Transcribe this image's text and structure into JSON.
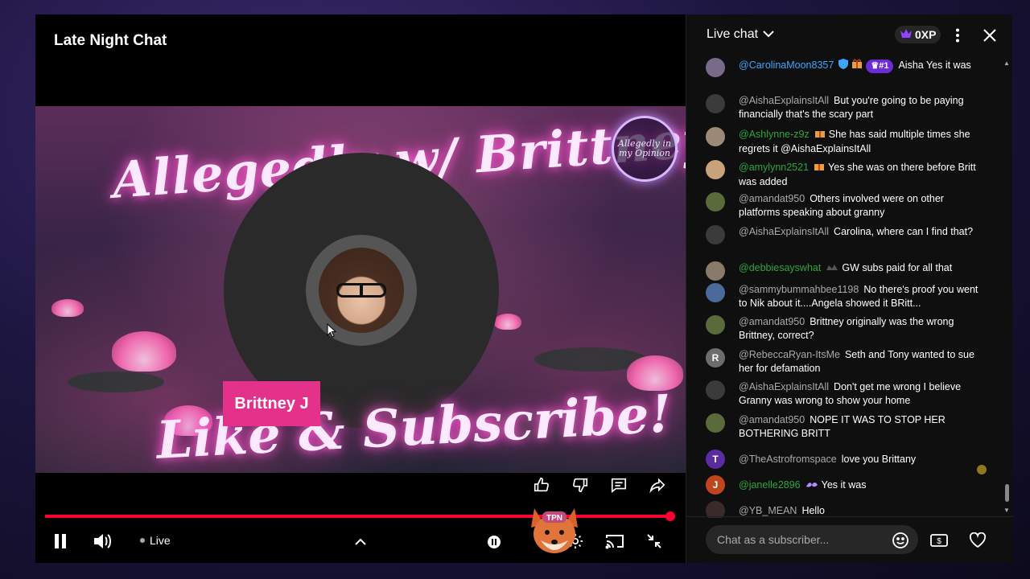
{
  "player": {
    "title": "Late Night Chat",
    "banner_text": "Allegedly w/ Brittney J",
    "cta_text": "Like & Subscribe!",
    "logo_text": "Allegedly in my Opinion",
    "speaker_name": "Brittney J",
    "live_label": "Live",
    "progress": 1.0,
    "accent_color": "#ff0033",
    "name_tag_color": "#e4328a",
    "mascot_text": "TPN"
  },
  "chat": {
    "title": "Live chat",
    "xp_label": "0XP",
    "input_placeholder": "Chat as a subscriber...",
    "messages": [
      {
        "author": "@CarolinaMoon8357",
        "rank": "#1",
        "text": "Aisha Yes it was",
        "avatar_color": "#7a6a8a",
        "avatar_letter": "",
        "member": false
      },
      {
        "author": "@AishaExplainsItAll",
        "text": "But you're going to be paying financially that's the scary part",
        "avatar_color": "#3b3b3b",
        "avatar_letter": "",
        "member": false
      },
      {
        "author": "@Ashlynne-z9z",
        "text": "She has said multiple times she regrets it @AishaExplainsItAll",
        "avatar_color": "#9b8a78",
        "avatar_letter": "",
        "member": true
      },
      {
        "author": "@amylynn2521",
        "text": "Yes she was on there before Britt was added",
        "avatar_color": "#c8a27a",
        "avatar_letter": "",
        "member": true
      },
      {
        "author": "@amandat950",
        "text": "Others involved were on other platforms speaking about granny",
        "avatar_color": "#5a6a3a",
        "avatar_letter": "",
        "member": false
      },
      {
        "author": "@AishaExplainsItAll",
        "text": "Carolina, where can I find that?",
        "avatar_color": "#3b3b3b",
        "avatar_letter": "",
        "member": false
      },
      {
        "author": "@debbiesayswhat",
        "text": "GW subs paid for all that",
        "avatar_color": "#8a7a6a",
        "avatar_letter": "",
        "member": true
      },
      {
        "author": "@sammybummahbee1198",
        "text": "No there's proof you went to Nik about it....Angela showed it BRitt...",
        "avatar_color": "#4a6a9a",
        "avatar_letter": "",
        "member": false
      },
      {
        "author": "@amandat950",
        "text": "Brittney originally was the wrong Brittney, correct?",
        "avatar_color": "#5a6a3a",
        "avatar_letter": "",
        "member": false
      },
      {
        "author": "@RebeccaRyan-ItsMe",
        "text": "Seth and Tony wanted to sue her for defamation",
        "avatar_color": "#6d6d6d",
        "avatar_letter": "R",
        "member": false
      },
      {
        "author": "@AishaExplainsItAll",
        "text": "Don't get me wrong I believe Granny was wrong to show your home",
        "avatar_color": "#3b3b3b",
        "avatar_letter": "",
        "member": false
      },
      {
        "author": "@amandat950",
        "text": "NOPE IT WAS TO STOP HER BOTHERING BRITT",
        "avatar_color": "#5a6a3a",
        "avatar_letter": "",
        "member": false
      },
      {
        "author": "@TheAstrofromspace",
        "text": "love you Brittany",
        "avatar_color": "#5b2ca0",
        "avatar_letter": "T",
        "member": false
      },
      {
        "author": "@janelle2896",
        "text": "Yes it was",
        "avatar_color": "#c0451e",
        "avatar_letter": "J",
        "member": true
      },
      {
        "author": "@YB_MEAN",
        "text": "Hello",
        "avatar_color": "#3b2a2a",
        "avatar_letter": "",
        "member": false
      }
    ]
  },
  "icons": {
    "like": "thumb-up-icon",
    "dislike": "thumb-down-icon",
    "comment": "comment-icon",
    "share": "share-icon",
    "pause": "pause-icon",
    "volume": "volume-icon",
    "chevron_up": "chevron-up-icon",
    "cast": "cast-icon",
    "exit_fullscreen": "exit-fullscreen-icon",
    "menu": "more-vert-icon",
    "close": "close-icon",
    "emoji": "emoji-icon",
    "super_chat": "super-chat-icon",
    "heart": "heart-icon",
    "crown": "crown-icon"
  },
  "colors": {
    "chat_bg": "#0f0f0f",
    "member_name": "#2ba640",
    "author_name": "#aaaaaa",
    "rank_chip": "#6b2bd6"
  }
}
